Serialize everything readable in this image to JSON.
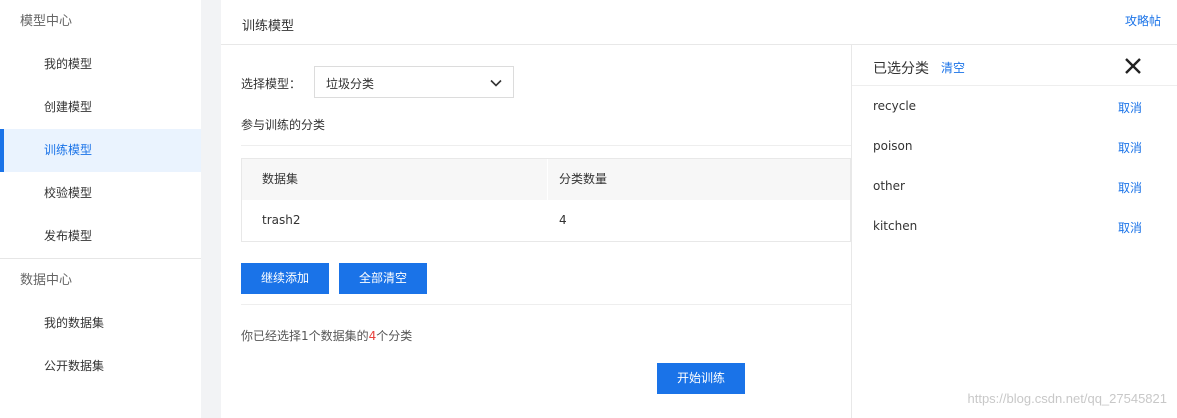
{
  "sidebar": {
    "groups": [
      {
        "title": "模型中心",
        "items": [
          "我的模型",
          "创建模型",
          "训练模型",
          "校验模型",
          "发布模型"
        ]
      },
      {
        "title": "数据中心",
        "items": [
          "我的数据集",
          "公开数据集"
        ]
      }
    ],
    "active_item": "训练模型"
  },
  "header": {
    "title": "训练模型",
    "help_link": "攻略帖"
  },
  "form": {
    "select_label": "选择模型：",
    "select_value": "垃圾分类",
    "section_title": "参与训练的分类"
  },
  "table": {
    "columns": [
      "数据集",
      "分类数量"
    ],
    "rows": [
      [
        "trash2",
        "4"
      ]
    ]
  },
  "buttons": {
    "add_more": "继续添加",
    "clear_all": "全部清空",
    "start_training": "开始训练"
  },
  "summary": {
    "prefix": "你已经选择1个数据集的",
    "count": "4",
    "suffix": "个分类"
  },
  "panel": {
    "title": "已选分类",
    "clear_label": "清空",
    "categories": [
      {
        "name": "recycle",
        "action": "取消"
      },
      {
        "name": "poison",
        "action": "取消"
      },
      {
        "name": "other",
        "action": "取消"
      },
      {
        "name": "kitchen",
        "action": "取消"
      }
    ]
  },
  "watermark": "https://blog.csdn.net/qq_27545821",
  "colors": {
    "accent": "#1a73e8",
    "highlight_number": "#e8413c",
    "active_bg": "#eaf3fe"
  }
}
